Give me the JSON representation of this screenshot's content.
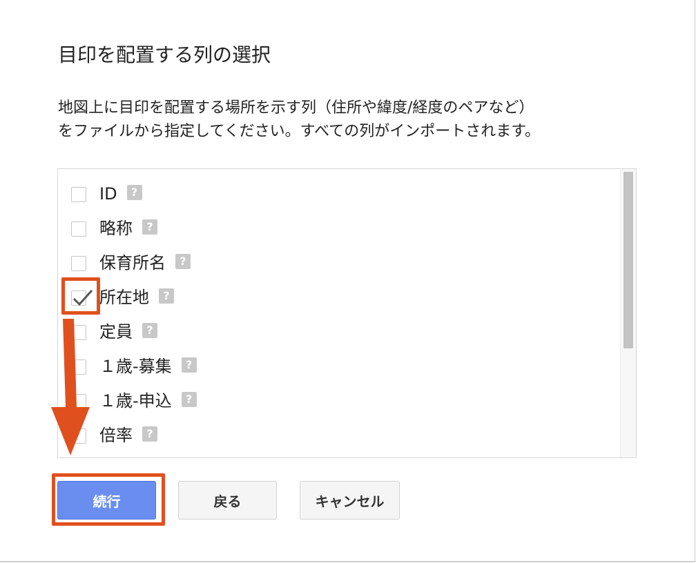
{
  "dialog": {
    "title": "目印を配置する列の選択",
    "description_line1": "地図上に目印を配置する場所を示す列（住所や緯度/経度のペアなど）",
    "description_line2": "をファイルから指定してください。すべての列がインポートされます。"
  },
  "columns": [
    {
      "label": "ID",
      "checked": false
    },
    {
      "label": "略称",
      "checked": false
    },
    {
      "label": "保育所名",
      "checked": false
    },
    {
      "label": "所在地",
      "checked": true
    },
    {
      "label": "定員",
      "checked": false
    },
    {
      "label": "１歳-募集",
      "checked": false
    },
    {
      "label": "１歳-申込",
      "checked": false
    },
    {
      "label": "倍率",
      "checked": false
    }
  ],
  "help_icon": {
    "glyph": "?",
    "icon": "help-icon"
  },
  "buttons": {
    "continue_label": "続行",
    "back_label": "戻る",
    "cancel_label": "キャンセル"
  },
  "colors": {
    "primary": "#6a8ef0",
    "annotation": "#e0501e"
  }
}
